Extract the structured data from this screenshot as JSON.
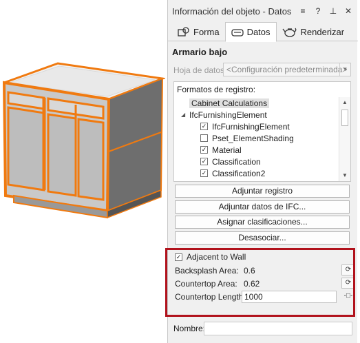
{
  "window": {
    "title": "Información del objeto - Datos",
    "controls": [
      "≡",
      "?",
      "⊥",
      "✕"
    ]
  },
  "tabs": [
    {
      "label": "Forma",
      "icon": "shape-icon"
    },
    {
      "label": "Datos",
      "icon": "data-icon",
      "active": true
    },
    {
      "label": "Renderizar",
      "icon": "render-teapot-icon"
    }
  ],
  "object": {
    "name": "Armario bajo"
  },
  "datasheet": {
    "label": "Hoja de datos:",
    "value": "<Configuración predeterminada>"
  },
  "formats": {
    "title": "Formatos de registro:",
    "items": [
      {
        "label": "Cabinet Calculations",
        "level": 0,
        "selected": true,
        "checkbox": false
      },
      {
        "label": "IfcFurnishingElement",
        "level": 0,
        "expander": "◢",
        "checkbox": false
      },
      {
        "label": "IfcFurnishingElement",
        "level": 1,
        "checkbox": true,
        "checked": true
      },
      {
        "label": "Pset_ElementShading",
        "level": 1,
        "checkbox": true,
        "checked": false
      },
      {
        "label": "Material",
        "level": 1,
        "checkbox": true,
        "checked": true
      },
      {
        "label": "Classification",
        "level": 1,
        "checkbox": true,
        "checked": true
      },
      {
        "label": "Classification2",
        "level": 1,
        "checkbox": true,
        "checked": true
      }
    ]
  },
  "buttons": {
    "attach_record": "Adjuntar registro",
    "attach_ifc": "Adjuntar datos de IFC...",
    "assign_class": "Asignar clasificaciones...",
    "detach": "Desasociar..."
  },
  "params": {
    "adjacent_label": "Adjacent to Wall",
    "adjacent_checked": true,
    "backsplash_label": "Backsplash Area:",
    "backsplash_value": "0.6",
    "countertop_area_label": "Countertop Area:",
    "countertop_area_value": "0.62",
    "countertop_length_label": "Countertop Length:",
    "countertop_length_value": "1000"
  },
  "name_field": {
    "label": "Nombre:",
    "value": ""
  },
  "colors": {
    "selection_orange": "#f07a10",
    "highlight_red": "#b1121c"
  }
}
